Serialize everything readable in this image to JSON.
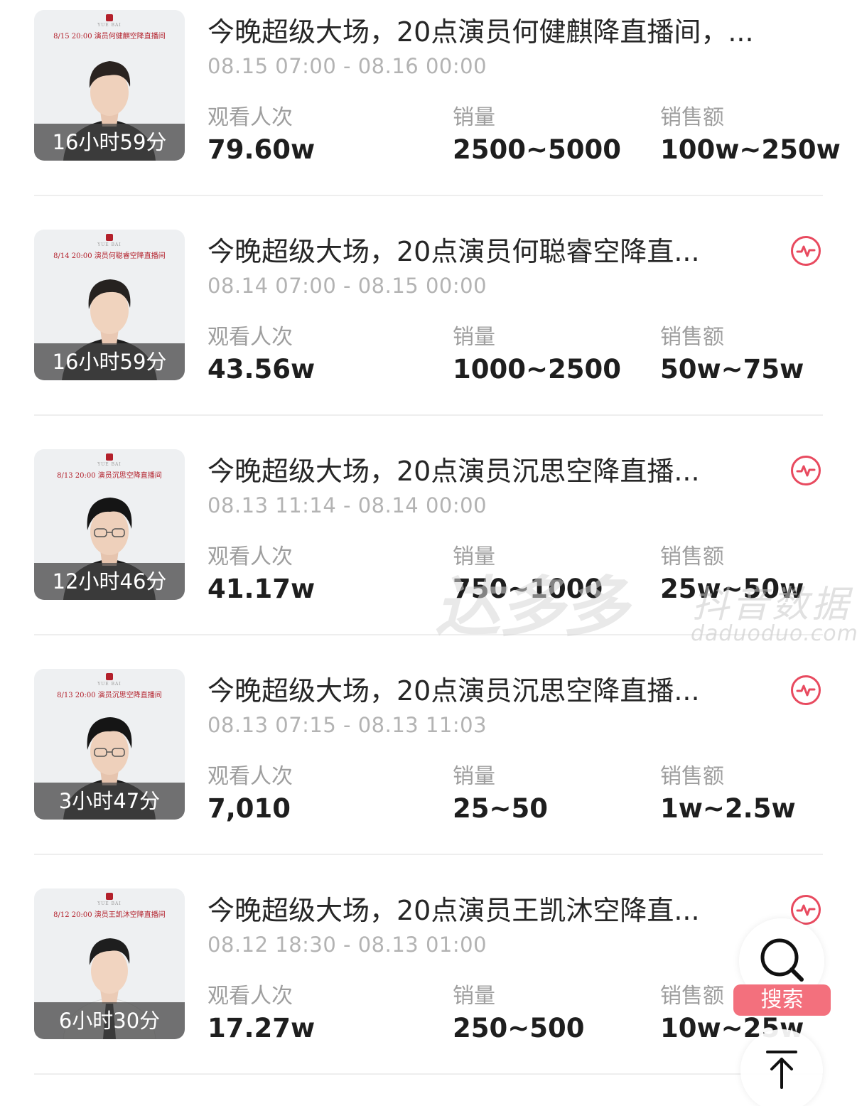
{
  "items": [
    {
      "poster_title": "8/15 20:00 演员何健麒空降直播间",
      "duration": "16小时59分",
      "title": "今晚超级大场，20点演员何健麒降直播间，...",
      "time": "08.15 07:00 - 08.16 00:00",
      "views_label": "观看人次",
      "views": "79.60w",
      "sales_label": "销量",
      "sales": "2500~5000",
      "amount_label": "销售额",
      "amount": "100w~250w",
      "has_pulse": false
    },
    {
      "poster_title": "8/14 20:00 演员何聪睿空降直播间",
      "duration": "16小时59分",
      "title": "今晚超级大场，20点演员何聪睿空降直...",
      "time": "08.14 07:00 - 08.15 00:00",
      "views_label": "观看人次",
      "views": "43.56w",
      "sales_label": "销量",
      "sales": "1000~2500",
      "amount_label": "销售额",
      "amount": "50w~75w",
      "has_pulse": true
    },
    {
      "poster_title": "8/13 20:00 演员沉思空降直播间",
      "duration": "12小时46分",
      "title": "今晚超级大场，20点演员沉思空降直播...",
      "time": "08.13 11:14 - 08.14 00:00",
      "views_label": "观看人次",
      "views": "41.17w",
      "sales_label": "销量",
      "sales": "750~1000",
      "amount_label": "销售额",
      "amount": "25w~50w",
      "has_pulse": true
    },
    {
      "poster_title": "8/13 20:00 演员沉思空降直播间",
      "duration": "3小时47分",
      "title": "今晚超级大场，20点演员沉思空降直播...",
      "time": "08.13 07:15 - 08.13 11:03",
      "views_label": "观看人次",
      "views": "7,010",
      "sales_label": "销量",
      "sales": "25~50",
      "amount_label": "销售额",
      "amount": "1w~2.5w",
      "has_pulse": true
    },
    {
      "poster_title": "8/12 20:00 演员王凯沐空降直播间",
      "duration": "6小时30分",
      "title": "今晚超级大场，20点演员王凯沐空降直...",
      "time": "08.12 18:30 - 08.13 01:00",
      "views_label": "观看人次",
      "views": "17.27w",
      "sales_label": "销量",
      "sales": "250~500",
      "amount_label": "销售额",
      "amount": "10w~25w",
      "has_pulse": true
    }
  ],
  "watermark": {
    "brand": "达多多",
    "subtitle": "抖音数据",
    "url": "daduoduo.com"
  },
  "fab": {
    "search_label": "搜索",
    "search_icon": "search-icon",
    "top_icon": "back-to-top-icon"
  },
  "colors": {
    "accent": "#e84a5f",
    "search_badge": "#f3707d",
    "poster_red": "#b3202b",
    "muted_text": "#9e9e9e"
  }
}
